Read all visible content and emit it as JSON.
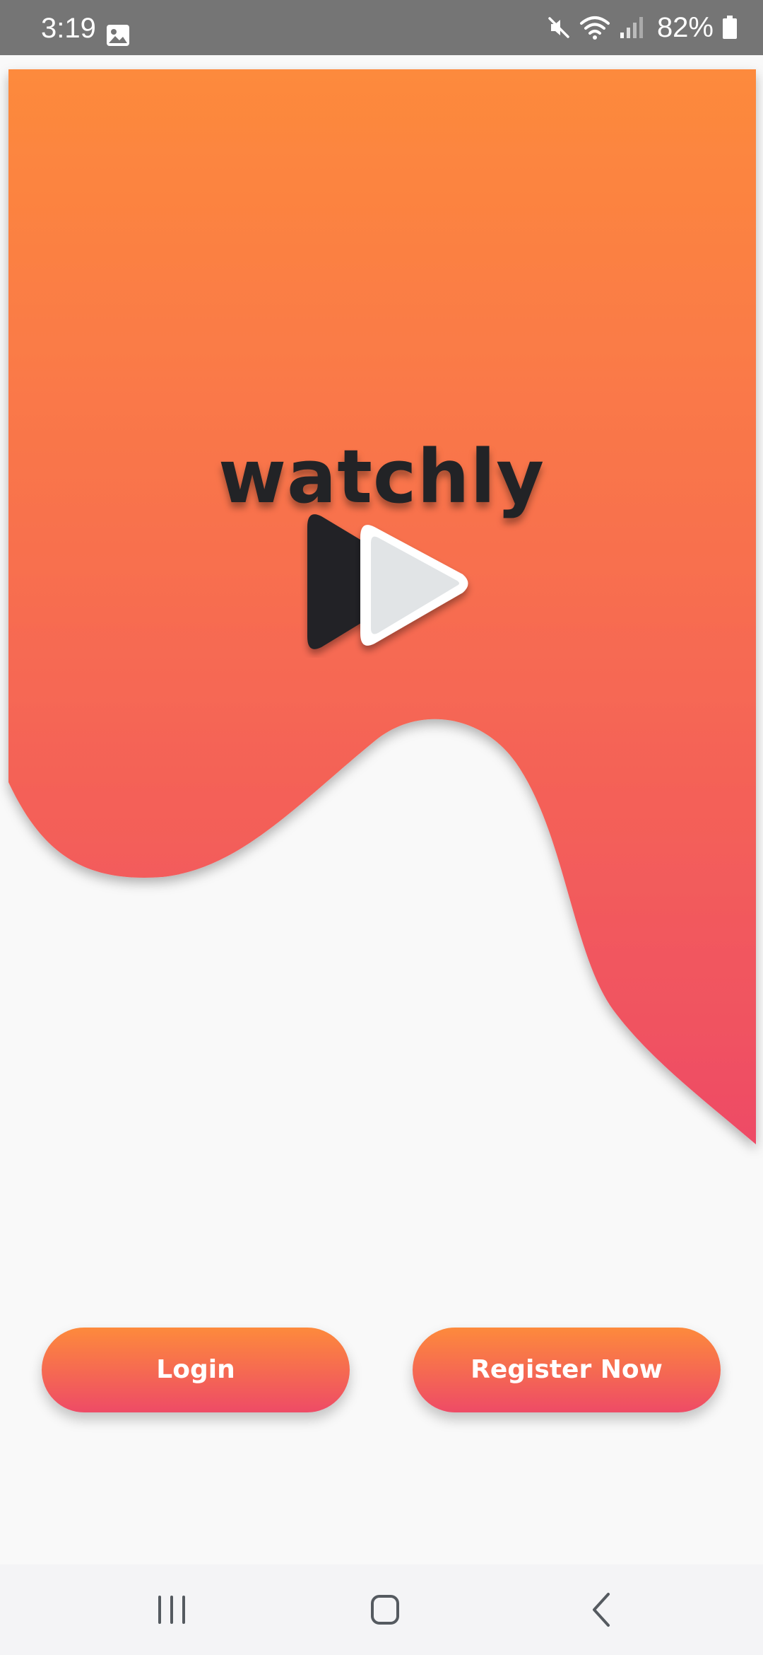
{
  "status_bar": {
    "time": "3:19",
    "battery": "82%",
    "icons": [
      "gallery-icon",
      "mute-icon",
      "wifi-icon",
      "signal-icon",
      "battery-icon"
    ]
  },
  "brand": {
    "name": "watchly",
    "logo_icon": "play-logo-icon"
  },
  "buttons": {
    "login_label": "Login",
    "register_label": "Register Now"
  },
  "nav_bar": {
    "icons": [
      "recents-icon",
      "home-icon",
      "back-icon"
    ]
  },
  "colors": {
    "gradient_top": "#fd8a3c",
    "gradient_bottom": "#ee4b66",
    "background": "#f9f9f9",
    "status_bar": "#757575",
    "logo_dark": "#222326",
    "logo_light": "#e4e6e8"
  }
}
